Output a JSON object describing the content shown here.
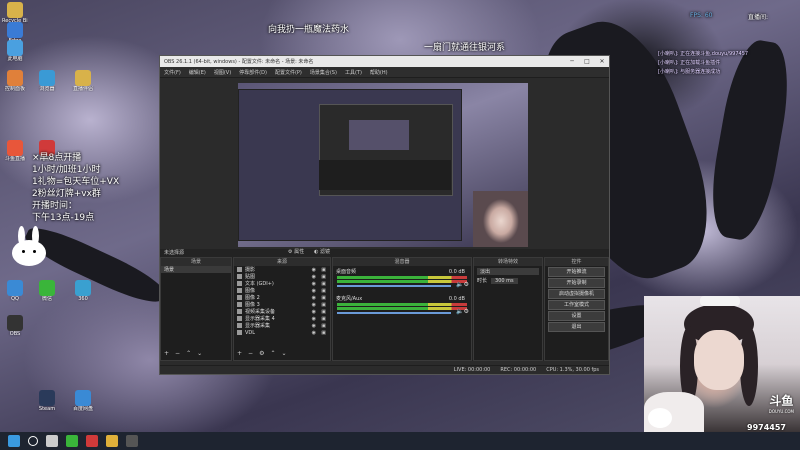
{
  "overlay": {
    "top_center": "向我扔一瓶魔法药水",
    "top_right": "一扇门就通往银河系",
    "schedule_lines": [
      "×早8点开播",
      "1小时/加班1小时",
      "1礼物=包天车位+VX",
      "2粉丝灯牌+vx群",
      "开播时间：",
      "下午13点-19点"
    ]
  },
  "stats": {
    "fps_label": "FPS:",
    "fps_value": "60",
    "live_label": "直播间:",
    "live_id": "9974457"
  },
  "chat": {
    "lines": [
      "[小喇叭]: 正在连接斗鱼,douyu/997457",
      "[小喇叭]: 正在加载斗鱼插件",
      "[小喇叭]: 与服务器连接成功"
    ]
  },
  "desktop_icons": [
    {
      "label": "Recycle Bin",
      "color": "#d8b24a"
    },
    {
      "label": "Edge",
      "color": "#3a7bd5"
    },
    {
      "label": "此电脑",
      "color": "#4aa0e0"
    },
    {
      "label": "控制面板",
      "color": "#e0803a"
    },
    {
      "label": "浏览器",
      "color": "#3a9ad5"
    },
    {
      "label": "斗鱼直播",
      "color": "#e8563a"
    },
    {
      "label": "网易云",
      "color": "#d03a3a"
    },
    {
      "label": "直播伴侣",
      "color": "#d8b24a"
    },
    {
      "label": "QQ",
      "color": "#3a8ad5"
    },
    {
      "label": "微信",
      "color": "#3ab53a"
    },
    {
      "label": "360",
      "color": "#3aa0d0"
    },
    {
      "label": "OBS",
      "color": "#333333"
    },
    {
      "label": "Steam",
      "color": "#2a3a5a"
    },
    {
      "label": "百度网盘",
      "color": "#3a8ad5"
    }
  ],
  "obs": {
    "title": "OBS 26.1.1 (64-bit, windows) - 配置文件: 未命名 - 场景: 未命名",
    "menu": [
      "文件(F)",
      "编辑(E)",
      "视图(V)",
      "停靠部件(D)",
      "配置文件(P)",
      "场景集合(S)",
      "工具(T)",
      "帮助(H)"
    ],
    "scene_bar_label": "未选择源",
    "props_label": "属性",
    "filters_label": "滤镜",
    "scenes_header": "场景",
    "scenes": [
      "场景"
    ],
    "sources_header": "来源",
    "sources": [
      "摄影",
      "贴图",
      "文本 (GDI+)",
      "图像",
      "图像 2",
      "图像 3",
      "视频采集设备",
      "显示器采集 4",
      "显示器采集",
      "VDL"
    ],
    "mixer_header": "混音器",
    "mixer": [
      {
        "name": "桌面音频",
        "db": "0.0 dB"
      },
      {
        "name": "麦克风/Aux",
        "db": "0.0 dB"
      }
    ],
    "transitions_header": "转场特效",
    "transition_type": "淡出",
    "duration_label": "时长",
    "duration_value": "300 ms",
    "controls_header": "控件",
    "controls": [
      "开始推流",
      "开始录制",
      "启动虚拟摄像机",
      "工作室模式",
      "设置",
      "退出"
    ],
    "status": {
      "live": "LIVE: 00:00:00",
      "rec": "REC: 00:00:00",
      "cpu": "CPU: 1.3%, 30.00 fps"
    }
  },
  "cam_logo": "斗鱼",
  "cam_site": "DOUYU.COM",
  "taskbar_icons": [
    {
      "name": "start",
      "color": "#3a9ae0"
    },
    {
      "name": "search",
      "color": "#ffffff"
    },
    {
      "name": "taskview",
      "color": "#cccccc"
    },
    {
      "name": "chat",
      "color": "#3ab53a"
    },
    {
      "name": "netease",
      "color": "#d03a3a"
    },
    {
      "name": "folder",
      "color": "#e0b03a"
    },
    {
      "name": "obs",
      "color": "#555555"
    }
  ]
}
